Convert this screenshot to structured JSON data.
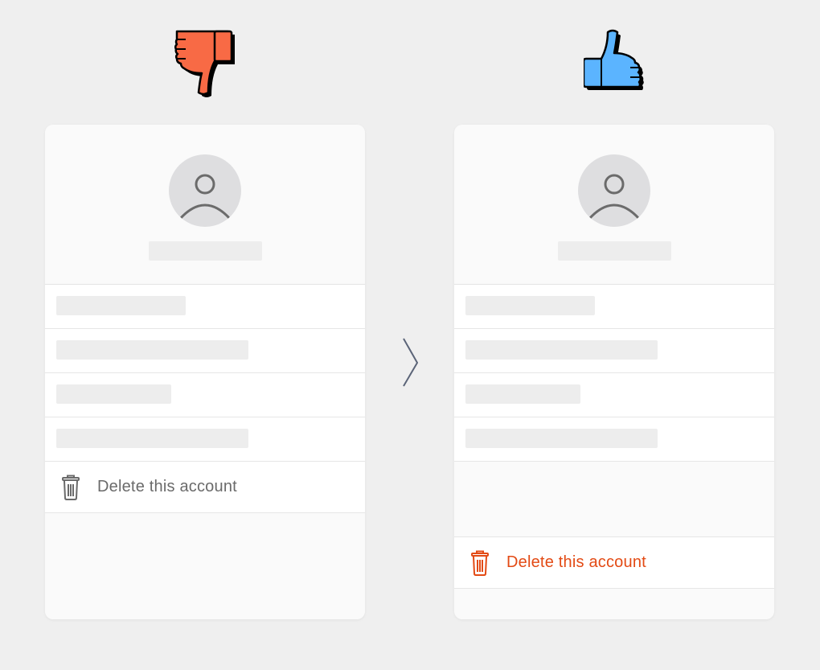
{
  "comparison": {
    "bad_icon": "thumbs-down-icon",
    "good_icon": "thumbs-up-icon",
    "arrow_icon": "chevron-right-icon",
    "colors": {
      "bad": "#f86a45",
      "good": "#5bb4ff",
      "danger_text": "#e34a14",
      "muted_text": "#6a6a6a"
    }
  },
  "left_panel": {
    "delete_label": "Delete this account",
    "delete_icon": "trash-icon",
    "avatar_icon": "user-icon"
  },
  "right_panel": {
    "delete_label": "Delete this account",
    "delete_icon": "trash-icon",
    "avatar_icon": "user-icon"
  }
}
